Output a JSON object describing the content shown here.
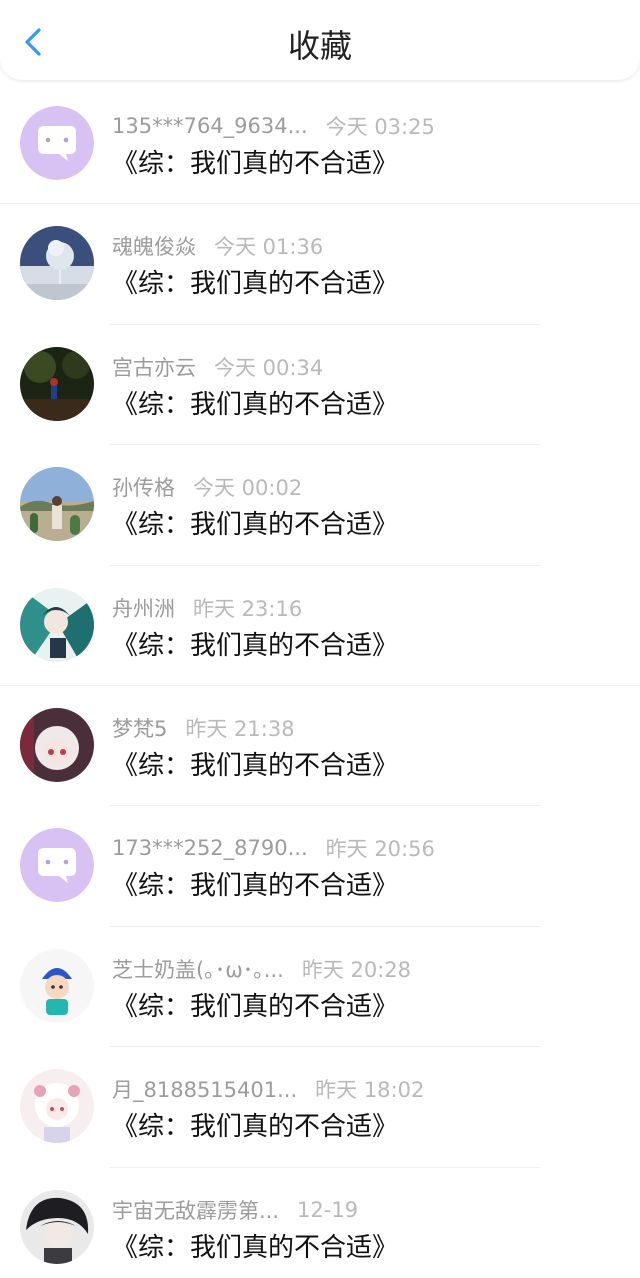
{
  "header": {
    "title": "收藏",
    "back_icon": "chevron-left-icon",
    "accent": "#2f9bff"
  },
  "items": [
    {
      "name": "135***764_9634...",
      "time": "今天 03:25",
      "book": "《综：我们真的不合适》",
      "avatar": "default-chat-avatar"
    },
    {
      "name": "魂魄俊焱",
      "time": "今天 01:36",
      "book": "《综：我们真的不合适》",
      "avatar": "winter-tree-photo"
    },
    {
      "name": "宫古亦云",
      "time": "今天 00:34",
      "book": "《综：我们真的不合适》",
      "avatar": "dark-forest-photo"
    },
    {
      "name": "孙传格",
      "time": "今天 00:02",
      "book": "《综：我们真的不合适》",
      "avatar": "outdoor-person-photo"
    },
    {
      "name": "舟州洲",
      "time": "昨天 23:16",
      "book": "《综：我们真的不合适》",
      "avatar": "anime-art-teal"
    },
    {
      "name": "梦梵5",
      "time": "昨天 21:38",
      "book": "《综：我们真的不合适》",
      "avatar": "anime-girl-white-hair"
    },
    {
      "name": "173***252_8790...",
      "time": "昨天 20:56",
      "book": "《综：我们真的不合适》",
      "avatar": "default-chat-avatar"
    },
    {
      "name": "芝士奶盖(｡･ω･｡...",
      "time": "昨天 20:28",
      "book": "《综：我们真的不合适》",
      "avatar": "cartoon-boy-blue-hat"
    },
    {
      "name": "月_8188515401...",
      "time": "昨天 18:02",
      "book": "《综：我们真的不合适》",
      "avatar": "anime-girl-pastel"
    },
    {
      "name": "宇宙无敌霹雳第...",
      "time": "12-19",
      "book": "《综：我们真的不合适》",
      "avatar": "dark-hair-sketch"
    }
  ]
}
